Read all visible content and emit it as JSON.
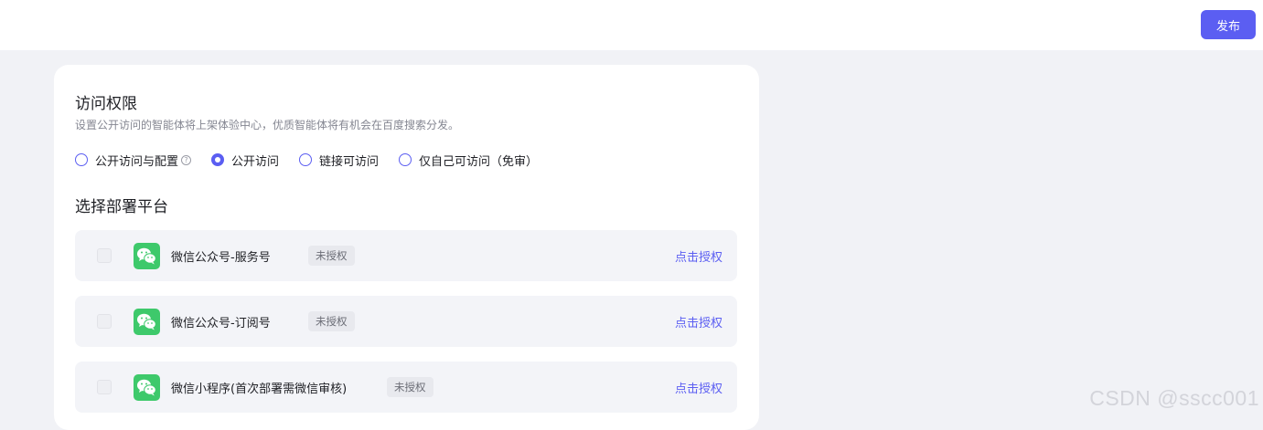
{
  "header": {
    "publish_label": "发布"
  },
  "access": {
    "title": "访问权限",
    "description": "设置公开访问的智能体将上架体验中心，优质智能体将有机会在百度搜索分发。",
    "options": [
      {
        "label": "公开访问与配置",
        "checked": false,
        "has_help": true
      },
      {
        "label": "公开访问",
        "checked": true
      },
      {
        "label": "链接可访问",
        "checked": false
      },
      {
        "label": "仅自己可访问（免审）",
        "checked": false
      }
    ]
  },
  "platform": {
    "title": "选择部署平台",
    "items": [
      {
        "name": "微信公众号-服务号",
        "status": "未授权",
        "action": "点击授权",
        "icon": "wechat-icon"
      },
      {
        "name": "微信公众号-订阅号",
        "status": "未授权",
        "action": "点击授权",
        "icon": "wechat-icon"
      },
      {
        "name": "微信小程序(首次部署需微信审核)",
        "status": "未授权",
        "action": "点击授权",
        "icon": "wechat-icon"
      }
    ]
  },
  "watermark": "CSDN @sscc001",
  "colors": {
    "accent": "#5b5ef2",
    "wechat": "#3ec96b",
    "page_bg": "#f1f2f6"
  }
}
